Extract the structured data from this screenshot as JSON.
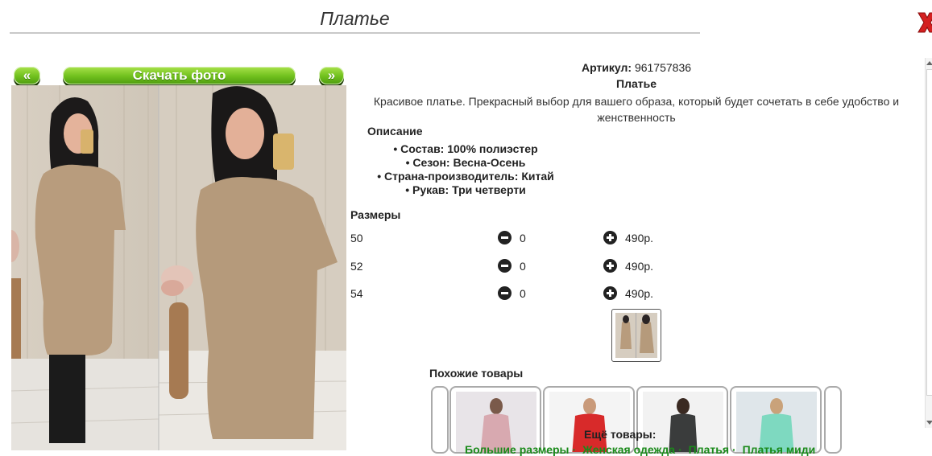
{
  "title": "Платье",
  "nav": {
    "prev": "«",
    "download": "Скачать фото",
    "next": "»"
  },
  "product": {
    "sku_label": "Артикул:",
    "sku": "961757836",
    "name": "Платье",
    "description": "Красивое платье. Прекрасный выбор для вашего образа, который будет сочетать в себе удобство и женственность",
    "desc_heading": "Описание",
    "specs": [
      "Состав: 100% полиэстер",
      "Сезон: Весна-Осень",
      "Страна-производитель: Китай",
      "Рукав: Три четверти"
    ]
  },
  "sizes": {
    "heading": "Размеры",
    "rows": [
      {
        "size": "50",
        "qty": "0",
        "price": "490р."
      },
      {
        "size": "52",
        "qty": "0",
        "price": "490р."
      },
      {
        "size": "54",
        "qty": "0",
        "price": "490р."
      }
    ]
  },
  "similar": {
    "heading": "Похожие товары"
  },
  "more": {
    "heading": "Ещё товары:",
    "links": [
      "Большие размеры",
      "Женская одежда",
      "Платья",
      "Платья миди"
    ]
  },
  "colors": {
    "accent_green": "#6fbf1d",
    "link_green": "#1a8a1a",
    "close_red": "#d42020"
  },
  "icons": [
    "close-icon",
    "minus-icon",
    "plus-icon"
  ]
}
